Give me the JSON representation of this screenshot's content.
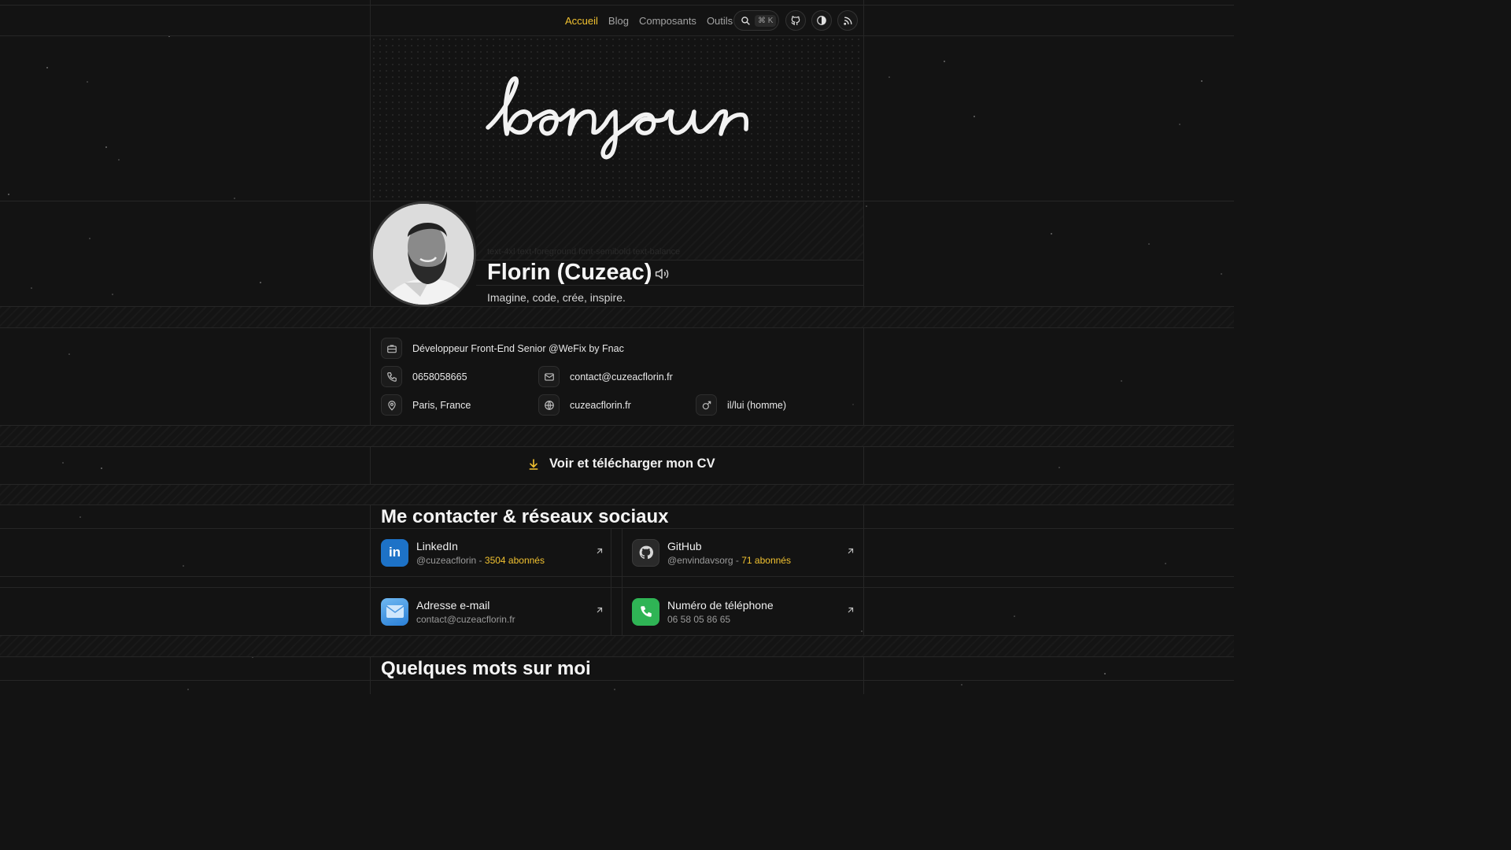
{
  "nav": {
    "links": [
      "Accueil",
      "Blog",
      "Composants",
      "Outils"
    ],
    "active": "Accueil",
    "search_shortcut": "⌘ K"
  },
  "hero": {
    "greeting": "bonjour",
    "ghost_text": "text-4xl text-foreground font-semibold text-balance",
    "name": "Florin (Cuzeac)",
    "tagline": "Imagine, code, crée, inspire."
  },
  "info": {
    "job": "Développeur Front-End Senior @WeFix by Fnac",
    "phone": "0658058665",
    "email": "contact@cuzeacflorin.fr",
    "location": "Paris, France",
    "website": "cuzeacflorin.fr",
    "pronouns": "il/lui (homme)"
  },
  "cv_button": "Voir et télécharger mon CV",
  "contact_section": {
    "title": "Me contacter & réseaux sociaux",
    "cards": [
      {
        "title": "LinkedIn",
        "handle": "@cuzeacflorin -",
        "followers": "3504 abonnés"
      },
      {
        "title": "GitHub",
        "handle": "@envindavsorg -",
        "followers": "71 abonnés"
      },
      {
        "title": "Adresse e-mail",
        "handle": "contact@cuzeacflorin.fr",
        "followers": ""
      },
      {
        "title": "Numéro de téléphone",
        "handle": "06 58 05 86 65",
        "followers": ""
      }
    ]
  },
  "about_title": "Quelques mots sur moi",
  "colors": {
    "accent": "#f2c230",
    "background": "#131313",
    "linkedin": "#1d72c7",
    "phone": "#2fb455"
  }
}
